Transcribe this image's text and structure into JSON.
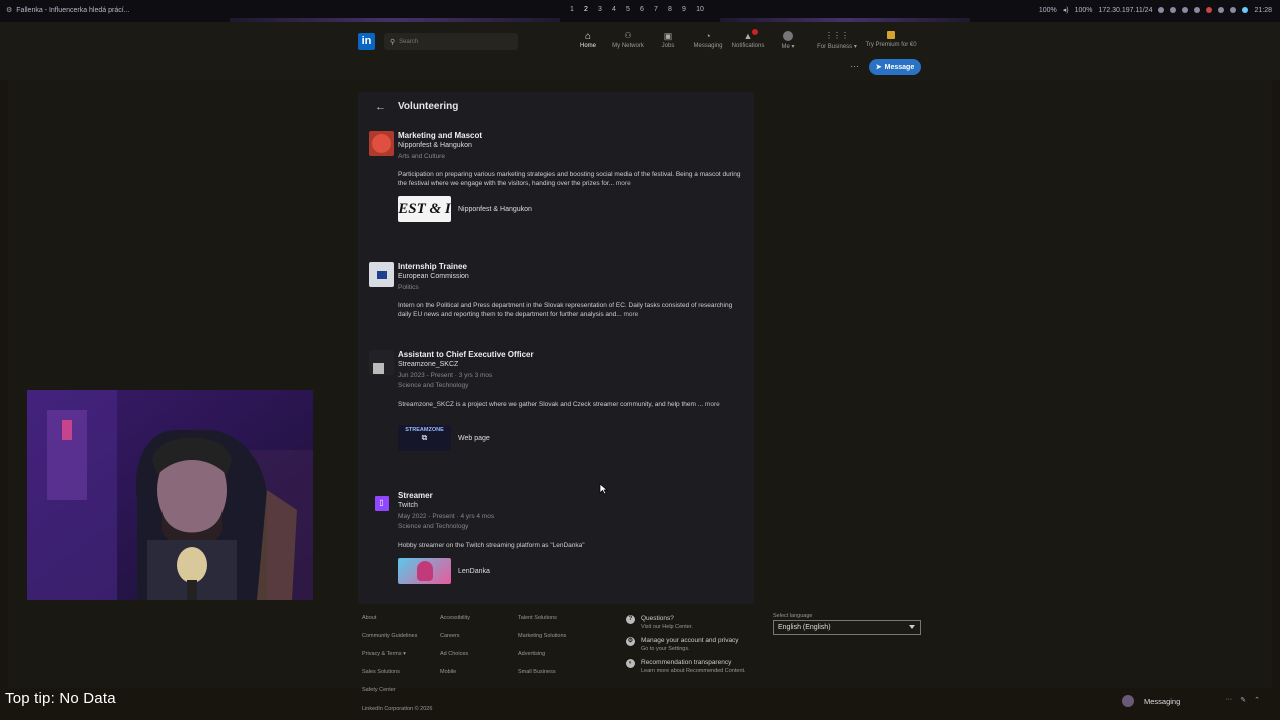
{
  "os_bar": {
    "window_title": "Fallenka - Influencerka hledá prácí...",
    "workspaces": [
      "1",
      "2",
      "3",
      "4",
      "5",
      "6",
      "7",
      "8",
      "9",
      "10"
    ],
    "active_workspace": "2",
    "volume1": "100%",
    "volume2": "100%",
    "ip": "172.30.197.11/24",
    "time": "21:28"
  },
  "nav": {
    "logo": "in",
    "search_placeholder": "Search",
    "items": [
      {
        "label": "Home",
        "icon": "home-icon",
        "glyph": "⌂"
      },
      {
        "label": "My Network",
        "icon": "network-icon",
        "glyph": "👥"
      },
      {
        "label": "Jobs",
        "icon": "briefcase-icon",
        "glyph": "💼"
      },
      {
        "label": "Messaging",
        "icon": "chat-icon",
        "glyph": "💬"
      },
      {
        "label": "Notifications",
        "icon": "bell-icon",
        "glyph": "🔔"
      },
      {
        "label": "Me ▾",
        "icon": "avatar-icon",
        "glyph": "●"
      },
      {
        "label": "For Business ▾",
        "icon": "grid-icon",
        "glyph": "⋮⋮⋮"
      },
      {
        "label": "Try Premium for €0",
        "icon": "premium-icon",
        "glyph": ""
      }
    ],
    "more": "···",
    "message_button": "Message"
  },
  "section": {
    "title": "Volunteering",
    "entries": [
      {
        "title": "Marketing and Mascot",
        "org": "Nipponfest & Hangukon",
        "meta": "Arts and Culture",
        "desc": "Participation on preparing various marketing strategies and boosting social media of the festival. Being a mascot during the festival where we engage with the visitors, handing over the prizes for...",
        "more": "more",
        "media_text": "EST & I",
        "media_label": "Nipponfest & Hangukon"
      },
      {
        "title": "Internship Trainee",
        "org": "European Commission",
        "meta": "Politics",
        "desc": "Intern on the Political and Press department in the Slovak representation of EC. Daily tasks consisted of researching daily EU news and reporting them to the department for further analysis and...",
        "more": "more"
      },
      {
        "title": "Assistant to Chief Executive Officer",
        "org": "Streamzone_SKCZ",
        "meta": "Jun 2023 - Present · 3 yrs 3 mos",
        "meta2": "Science and Technology",
        "desc": "Streamzone_SKCZ is a project where we gather Slovak and Czeck streamer community, and help them ...",
        "more": "more",
        "media_text": "STREAMZONE",
        "media_label": "Web page"
      },
      {
        "title": "Streamer",
        "org": "Twitch",
        "meta": "May 2022 - Present · 4 yrs 4 mos",
        "meta2": "Science and Technology",
        "desc": "Hobby streamer on the Twitch streaming platform as \"LenDanka\"",
        "media_label": "LenDanka"
      }
    ]
  },
  "footer": {
    "col1": [
      "About",
      "Community Guidelines",
      "Privacy & Terms ▾",
      "Sales Solutions",
      "Safety Center"
    ],
    "col2": [
      "Accessibility",
      "Careers",
      "Ad Choices",
      "Mobile"
    ],
    "col3": [
      "Talent Solutions",
      "Marketing Solutions",
      "Advertising",
      "Small Business"
    ],
    "help": [
      {
        "title": "Questions?",
        "sub": "Visit our Help Center.",
        "icon": "question-icon",
        "glyph": "?"
      },
      {
        "title": "Manage your account and privacy",
        "sub": "Go to your Settings.",
        "icon": "gear-icon",
        "glyph": "⚙"
      },
      {
        "title": "Recommendation transparency",
        "sub": "Learn more about Recommended Content.",
        "icon": "shield-icon",
        "glyph": "◐"
      }
    ],
    "lang_label": "Select language",
    "lang_value": "English (English)",
    "copyright": "LinkedIn Corporation © 2026"
  },
  "overlay": {
    "top_tip": "Top tip: No Data"
  },
  "messaging_bar": {
    "label": "Messaging"
  },
  "colors": {
    "accent": "#0a66c2",
    "message_button": "#2a73c4",
    "background": "#17150e",
    "card": "#1d1c20"
  }
}
